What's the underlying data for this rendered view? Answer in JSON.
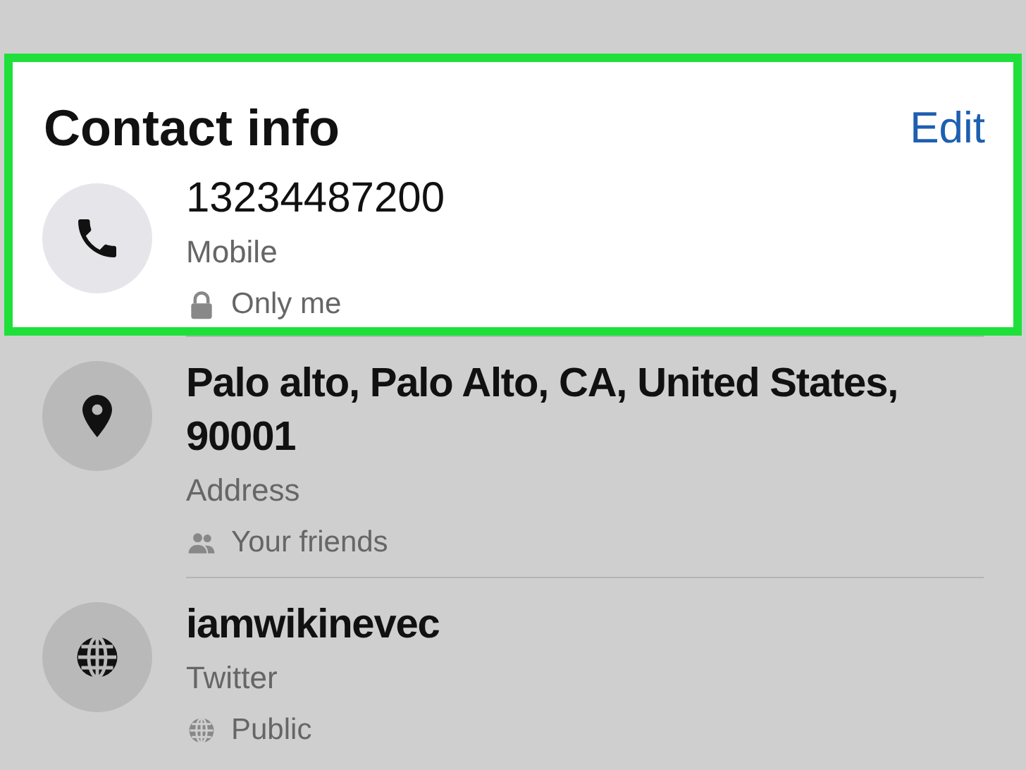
{
  "section": {
    "title": "Contact info",
    "edit_link": "Edit",
    "highlighted": true
  },
  "items": [
    {
      "value": "13234487200",
      "label": "Mobile",
      "privacy": "Only me"
    },
    {
      "value": "Palo alto, Palo Alto, CA, United States, 90001",
      "label": "Address",
      "privacy": "Your friends"
    },
    {
      "value": "iamwikinevec",
      "label": "Twitter",
      "privacy": "Public"
    }
  ]
}
